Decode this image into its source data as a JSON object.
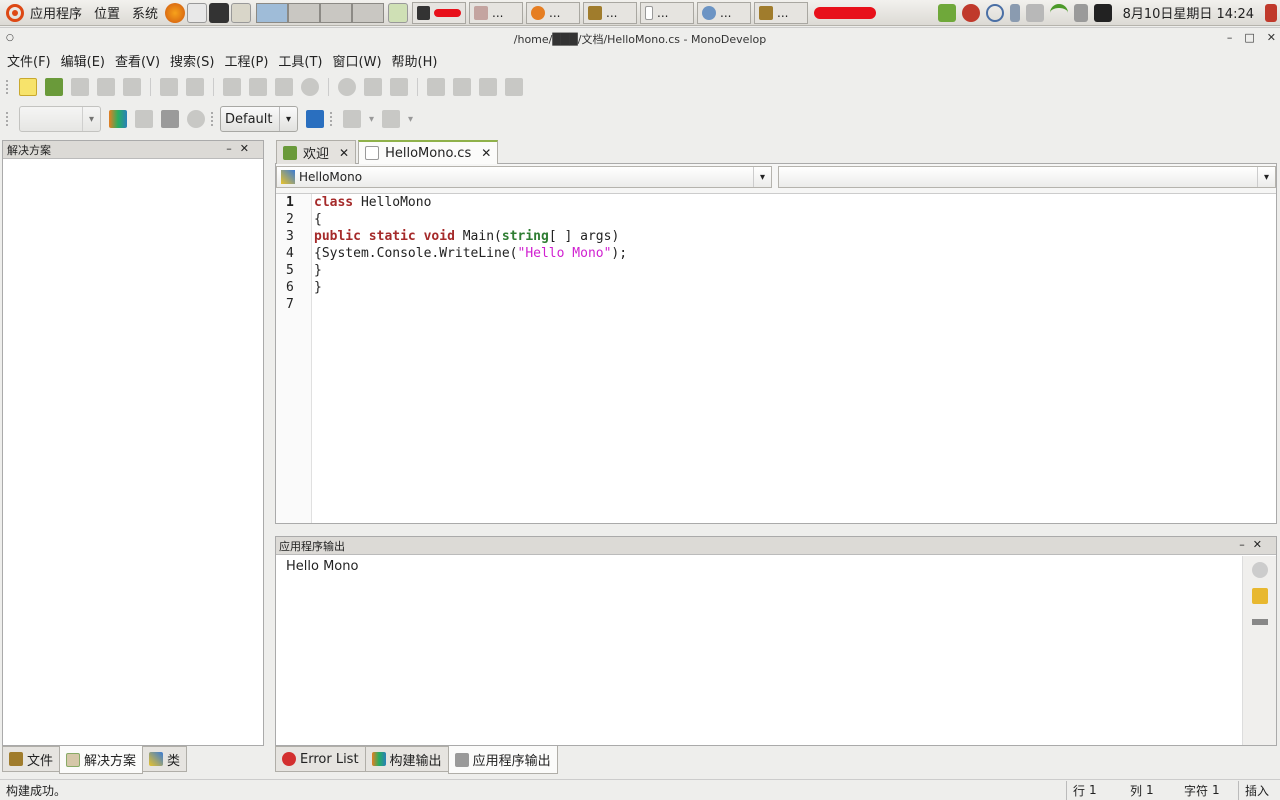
{
  "panel": {
    "menus": [
      "应用程序",
      "位置",
      "系统"
    ],
    "tasks": [
      {
        "label": "...",
        "icon": "terminal-icon"
      },
      {
        "label": "...",
        "icon": "gimp-icon"
      },
      {
        "label": "...",
        "icon": "firefox-icon"
      },
      {
        "label": "...",
        "icon": "folder-icon"
      },
      {
        "label": "...",
        "icon": "document-icon"
      },
      {
        "label": "...",
        "icon": "monodevelop-icon"
      },
      {
        "label": "...",
        "icon": "folder-icon"
      }
    ],
    "clock": "8月10日星期日  14:24"
  },
  "window": {
    "title": "/home/███/文档/HelloMono.cs - MonoDevelop"
  },
  "menubar": [
    "文件(F)",
    "编辑(E)",
    "查看(V)",
    "搜索(S)",
    "工程(P)",
    "工具(T)",
    "窗口(W)",
    "帮助(H)"
  ],
  "toolbar": {
    "config_value": "Default"
  },
  "left_pad": {
    "title": "解决方案",
    "tabs": [
      {
        "label": "文件",
        "icon": "files-icon"
      },
      {
        "label": "解决方案",
        "icon": "solution-icon"
      },
      {
        "label": "类",
        "icon": "class-icon"
      }
    ]
  },
  "editor": {
    "tabs": [
      {
        "label": "欢迎",
        "icon": "home-icon"
      },
      {
        "label": "HelloMono.cs",
        "icon": "file-icon"
      }
    ],
    "path_class": "HelloMono",
    "path_member": "",
    "line_numbers": [
      "1",
      "2",
      "3",
      "4",
      "5",
      "6",
      "7"
    ],
    "code": [
      [
        {
          "t": "class",
          "c": "kw"
        },
        {
          "t": " HelloMono",
          "c": ""
        }
      ],
      [
        {
          "t": "{",
          "c": ""
        }
      ],
      [
        {
          "t": "public",
          "c": "kw"
        },
        {
          "t": " ",
          "c": ""
        },
        {
          "t": "static",
          "c": "kw"
        },
        {
          "t": " ",
          "c": ""
        },
        {
          "t": "void",
          "c": "kw"
        },
        {
          "t": " Main(",
          "c": ""
        },
        {
          "t": "string",
          "c": "ty"
        },
        {
          "t": "[ ] args)",
          "c": ""
        }
      ],
      [
        {
          "t": "{System.Console.WriteLine(",
          "c": ""
        },
        {
          "t": "\"Hello Mono\"",
          "c": "st"
        },
        {
          "t": ");",
          "c": ""
        }
      ],
      [
        {
          "t": "}",
          "c": ""
        }
      ],
      [
        {
          "t": "}",
          "c": ""
        }
      ],
      [
        {
          "t": "",
          "c": ""
        }
      ]
    ]
  },
  "output_pad": {
    "title": "应用程序输出",
    "text": "Hello Mono",
    "tabs": [
      {
        "label": "Error List",
        "icon": "error-icon"
      },
      {
        "label": "构建输出",
        "icon": "build-icon"
      },
      {
        "label": "应用程序输出",
        "icon": "app-output-icon"
      }
    ]
  },
  "status": {
    "message": "构建成功。",
    "line_label": "行",
    "line_value": "1",
    "col_label": "列",
    "col_value": "1",
    "char_label": "字符",
    "char_value": "1",
    "mode": "插入"
  }
}
